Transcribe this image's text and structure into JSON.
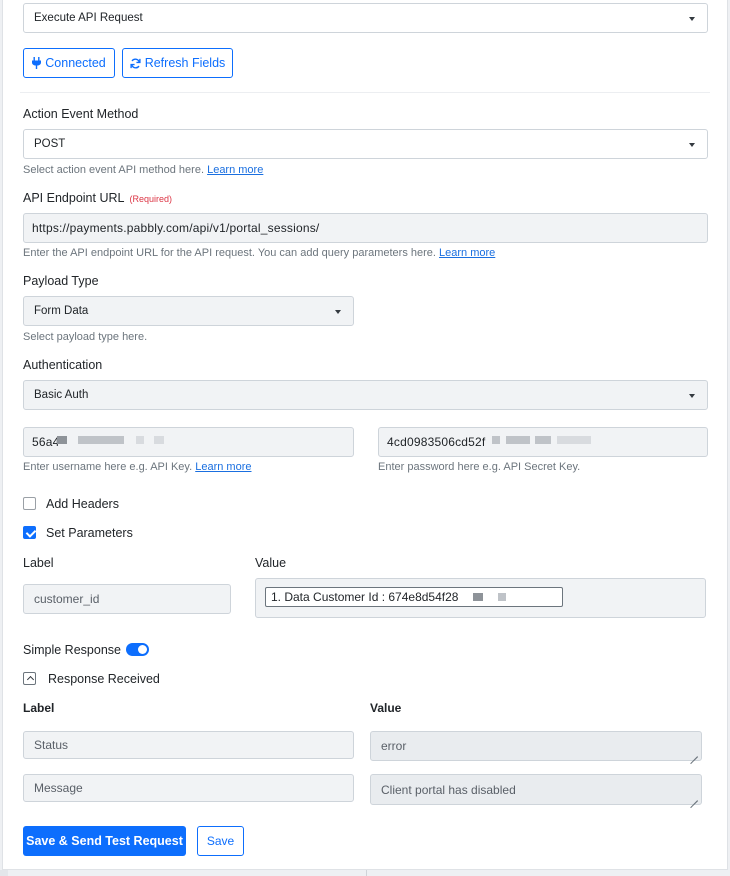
{
  "action_event": {
    "selected": "Execute API Request"
  },
  "buttons": {
    "connected": "Connected",
    "refresh_fields": "Refresh Fields",
    "save_send_test": "Save & Send Test Request",
    "save": "Save"
  },
  "method": {
    "label": "Action Event Method",
    "selected": "POST",
    "help": "Select action event API method here.",
    "learn_more": "Learn more"
  },
  "endpoint": {
    "label": "API Endpoint URL",
    "required": "(Required)",
    "value": "https://payments.pabbly.com/api/v1/portal_sessions/",
    "help": "Enter the API endpoint URL for the API request. You can add query parameters here.",
    "learn_more": "Learn more"
  },
  "payload": {
    "label": "Payload Type",
    "selected": "Form Data",
    "help": "Select payload type here."
  },
  "authentication": {
    "label": "Authentication",
    "selected": "Basic Auth",
    "username_value": "56a4",
    "username_help": "Enter username here e.g. API Key.",
    "learn_more": "Learn more",
    "password_value": "4cd0983506cd52f",
    "password_help": "Enter password here e.g. API Secret Key."
  },
  "add_headers": {
    "label": "Add Headers",
    "checked": false
  },
  "set_parameters": {
    "label": "Set Parameters",
    "checked": true,
    "label_header": "Label",
    "value_header": "Value",
    "rows": [
      {
        "label": "customer_id",
        "value": "1. Data Customer Id : 674e8d54f28"
      }
    ]
  },
  "simple_response": {
    "label": "Simple Response",
    "enabled": true
  },
  "response_received": {
    "label": "Response Received",
    "label_header": "Label",
    "value_header": "Value",
    "rows": [
      {
        "label": "Status",
        "value": "error"
      },
      {
        "label": "Message",
        "value": "Client portal has disabled"
      }
    ]
  },
  "colors": {
    "primary": "#0d6efd",
    "required": "#dc3545",
    "link": "#1a6fe0"
  }
}
